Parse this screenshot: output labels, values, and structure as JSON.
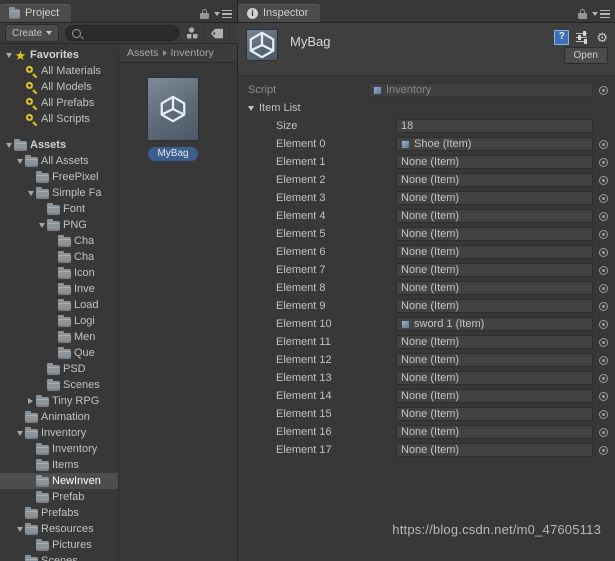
{
  "project": {
    "tab_label": "Project",
    "tab_icon": "folder-icon",
    "lock_icon": "lock-icon",
    "menu_icon": "hamburger-menu-icon",
    "toolbar": {
      "create_label": "Create",
      "create_caret_icon": "chevron-down-icon",
      "search_placeholder": "",
      "search_value": "",
      "search_icon": "search-icon",
      "filter_type_icon": "filter-by-type-icon",
      "filter_label_icon": "filter-by-label-icon",
      "filter_favorite_icon": "filter-by-favorite-star-icon"
    },
    "tree": [
      {
        "label": "Favorites",
        "depth": 0,
        "twisty": "down",
        "icon": "star-icon",
        "bold": true,
        "selected": false
      },
      {
        "label": "All Materials",
        "depth": 1,
        "twisty": "none",
        "icon": "search-icon",
        "bold": false,
        "selected": false
      },
      {
        "label": "All Models",
        "depth": 1,
        "twisty": "none",
        "icon": "search-icon",
        "bold": false,
        "selected": false
      },
      {
        "label": "All Prefabs",
        "depth": 1,
        "twisty": "none",
        "icon": "search-icon",
        "bold": false,
        "selected": false
      },
      {
        "label": "All Scripts",
        "depth": 1,
        "twisty": "none",
        "icon": "search-icon",
        "bold": false,
        "selected": false
      },
      {
        "label": "",
        "depth": 0,
        "twisty": "none",
        "icon": "none",
        "bold": false,
        "selected": false
      },
      {
        "label": "Assets",
        "depth": 0,
        "twisty": "down",
        "icon": "folder-icon",
        "bold": true,
        "selected": false
      },
      {
        "label": "All Assets",
        "depth": 1,
        "twisty": "down",
        "icon": "folder-icon",
        "bold": false,
        "selected": false
      },
      {
        "label": "FreePixel",
        "depth": 2,
        "twisty": "none",
        "icon": "folder-icon",
        "bold": false,
        "selected": false
      },
      {
        "label": "Simple Fa",
        "depth": 2,
        "twisty": "down",
        "icon": "folder-icon",
        "bold": false,
        "selected": false
      },
      {
        "label": "Font",
        "depth": 3,
        "twisty": "none",
        "icon": "folder-icon",
        "bold": false,
        "selected": false
      },
      {
        "label": "PNG",
        "depth": 3,
        "twisty": "down",
        "icon": "folder-icon",
        "bold": false,
        "selected": false
      },
      {
        "label": "Cha",
        "depth": 4,
        "twisty": "none",
        "icon": "folder-icon",
        "bold": false,
        "selected": false
      },
      {
        "label": "Cha",
        "depth": 4,
        "twisty": "none",
        "icon": "folder-icon",
        "bold": false,
        "selected": false
      },
      {
        "label": "Icon",
        "depth": 4,
        "twisty": "none",
        "icon": "folder-icon",
        "bold": false,
        "selected": false
      },
      {
        "label": "Inve",
        "depth": 4,
        "twisty": "none",
        "icon": "folder-icon",
        "bold": false,
        "selected": false
      },
      {
        "label": "Load",
        "depth": 4,
        "twisty": "none",
        "icon": "folder-icon",
        "bold": false,
        "selected": false
      },
      {
        "label": "Logi",
        "depth": 4,
        "twisty": "none",
        "icon": "folder-icon",
        "bold": false,
        "selected": false
      },
      {
        "label": "Men",
        "depth": 4,
        "twisty": "none",
        "icon": "folder-icon",
        "bold": false,
        "selected": false
      },
      {
        "label": "Que",
        "depth": 4,
        "twisty": "none",
        "icon": "folder-icon",
        "bold": false,
        "selected": false
      },
      {
        "label": "PSD",
        "depth": 3,
        "twisty": "none",
        "icon": "folder-icon",
        "bold": false,
        "selected": false
      },
      {
        "label": "Scenes",
        "depth": 3,
        "twisty": "none",
        "icon": "folder-icon",
        "bold": false,
        "selected": false
      },
      {
        "label": "Tiny RPG",
        "depth": 2,
        "twisty": "right",
        "icon": "folder-icon",
        "bold": false,
        "selected": false
      },
      {
        "label": "Animation",
        "depth": 1,
        "twisty": "none",
        "icon": "folder-icon",
        "bold": false,
        "selected": false
      },
      {
        "label": "Inventory",
        "depth": 1,
        "twisty": "down",
        "icon": "folder-icon",
        "bold": false,
        "selected": false
      },
      {
        "label": "Inventory",
        "depth": 2,
        "twisty": "none",
        "icon": "folder-icon",
        "bold": false,
        "selected": false
      },
      {
        "label": "Items",
        "depth": 2,
        "twisty": "none",
        "icon": "folder-icon",
        "bold": false,
        "selected": false
      },
      {
        "label": "NewInven",
        "depth": 2,
        "twisty": "none",
        "icon": "folder-icon",
        "bold": false,
        "selected": true
      },
      {
        "label": "Prefab",
        "depth": 2,
        "twisty": "none",
        "icon": "folder-icon",
        "bold": false,
        "selected": false
      },
      {
        "label": "Prefabs",
        "depth": 1,
        "twisty": "none",
        "icon": "folder-icon",
        "bold": false,
        "selected": false
      },
      {
        "label": "Resources",
        "depth": 1,
        "twisty": "down",
        "icon": "folder-icon",
        "bold": false,
        "selected": false
      },
      {
        "label": "Pictures",
        "depth": 2,
        "twisty": "none",
        "icon": "folder-icon",
        "bold": false,
        "selected": false
      },
      {
        "label": "Scenes",
        "depth": 1,
        "twisty": "none",
        "icon": "folder-icon",
        "bold": false,
        "selected": false
      }
    ],
    "breadcrumb": [
      "Assets",
      "Inventory"
    ],
    "assets": [
      {
        "name": "MyBag",
        "icon": "unity-asset-icon",
        "selected": true
      }
    ]
  },
  "inspector": {
    "tab_label": "Inspector",
    "tab_icon": "info-icon",
    "lock_icon": "lock-icon",
    "menu_icon": "hamburger-menu-icon",
    "object_name": "MyBag",
    "object_icon": "unity-asset-icon",
    "help_icon": "help-book-icon",
    "preset_icon": "preset-sliders-icon",
    "settings_icon": "gear-icon",
    "open_button": "Open",
    "script_row": {
      "label": "Script",
      "value": "Inventory",
      "icon": "script-asset-icon",
      "disabled": true
    },
    "item_list": {
      "foldout_label": "Item List",
      "foldout_icon": "chevron-down-icon",
      "expanded": true,
      "size_label": "Size",
      "size_value": "18",
      "elements": [
        {
          "label": "Element 0",
          "value": "Shoe (Item)",
          "has_object": true
        },
        {
          "label": "Element 1",
          "value": "None (Item)",
          "has_object": false
        },
        {
          "label": "Element 2",
          "value": "None (Item)",
          "has_object": false
        },
        {
          "label": "Element 3",
          "value": "None (Item)",
          "has_object": false
        },
        {
          "label": "Element 4",
          "value": "None (Item)",
          "has_object": false
        },
        {
          "label": "Element 5",
          "value": "None (Item)",
          "has_object": false
        },
        {
          "label": "Element 6",
          "value": "None (Item)",
          "has_object": false
        },
        {
          "label": "Element 7",
          "value": "None (Item)",
          "has_object": false
        },
        {
          "label": "Element 8",
          "value": "None (Item)",
          "has_object": false
        },
        {
          "label": "Element 9",
          "value": "None (Item)",
          "has_object": false
        },
        {
          "label": "Element 10",
          "value": "sword 1 (Item)",
          "has_object": true
        },
        {
          "label": "Element 11",
          "value": "None (Item)",
          "has_object": false
        },
        {
          "label": "Element 12",
          "value": "None (Item)",
          "has_object": false
        },
        {
          "label": "Element 13",
          "value": "None (Item)",
          "has_object": false
        },
        {
          "label": "Element 14",
          "value": "None (Item)",
          "has_object": false
        },
        {
          "label": "Element 15",
          "value": "None (Item)",
          "has_object": false
        },
        {
          "label": "Element 16",
          "value": "None (Item)",
          "has_object": false
        },
        {
          "label": "Element 17",
          "value": "None (Item)",
          "has_object": false
        }
      ]
    }
  },
  "watermark": "https://blog.csdn.net/m0_47605113"
}
